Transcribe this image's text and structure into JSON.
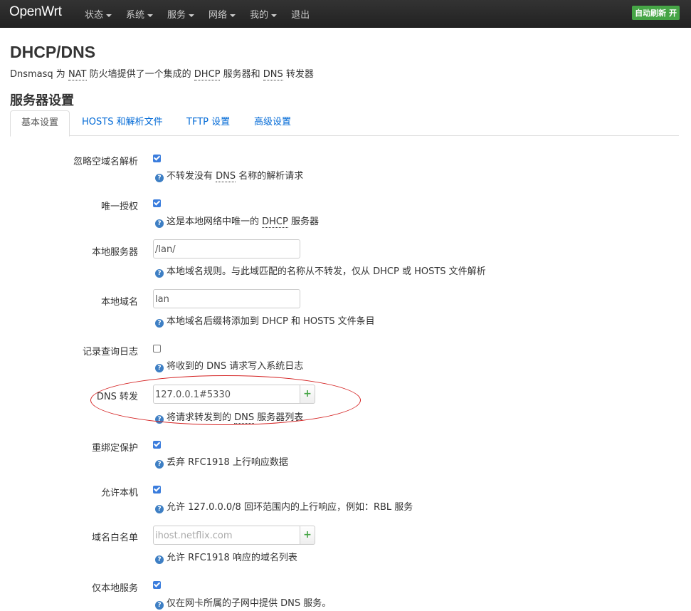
{
  "navbar": {
    "brand": "OpenWrt",
    "menu": [
      {
        "label": "状态",
        "dropdown": true
      },
      {
        "label": "系统",
        "dropdown": true
      },
      {
        "label": "服务",
        "dropdown": true
      },
      {
        "label": "网络",
        "dropdown": true
      },
      {
        "label": "我的",
        "dropdown": true
      },
      {
        "label": "退出",
        "dropdown": false
      }
    ],
    "refresh_badge": "自动刷新 开"
  },
  "page": {
    "title": "DHCP/DNS",
    "description_parts": [
      "Dnsmasq 为 ",
      "NAT",
      " 防火墙提供了一个集成的 ",
      "DHCP",
      " 服务器和 ",
      "DNS",
      " 转发器"
    ]
  },
  "section": {
    "title": "服务器设置",
    "tabs": [
      "基本设置",
      "HOSTS 和解析文件",
      "TFTP 设置",
      "高级设置"
    ]
  },
  "fields": {
    "domainneeded": {
      "label": "忽略空域名解析",
      "checked": true,
      "hint_parts": [
        "不转发没有 ",
        "DNS",
        " 名称的解析请求"
      ]
    },
    "authoritative": {
      "label": "唯一授权",
      "checked": true,
      "hint_parts": [
        "这是本地网络中唯一的 ",
        "DHCP",
        " 服务器"
      ]
    },
    "local": {
      "label": "本地服务器",
      "value": "/lan/",
      "hint": "本地域名规则。与此域匹配的名称从不转发，仅从 DHCP 或 HOSTS 文件解析"
    },
    "domain": {
      "label": "本地域名",
      "value": "lan",
      "hint": "本地域名后缀将添加到 DHCP 和 HOSTS 文件条目"
    },
    "logqueries": {
      "label": "记录查询日志",
      "checked": false,
      "hint": "将收到的 DNS 请求写入系统日志"
    },
    "server": {
      "label": "DNS 转发",
      "value": "127.0.0.1#5330",
      "add": "+",
      "hint_parts": [
        "将请求转发到的 ",
        "DNS",
        " 服务器列表"
      ]
    },
    "rebind_protection": {
      "label": "重绑定保护",
      "checked": true,
      "hint": "丢弃 RFC1918 上行响应数据"
    },
    "rebind_localhost": {
      "label": "允许本机",
      "checked": true,
      "hint": "允许 127.0.0.0/8 回环范围内的上行响应，例如：RBL 服务"
    },
    "rebind_domain": {
      "label": "域名白名单",
      "placeholder": "ihost.netflix.com",
      "add": "+",
      "hint": "允许 RFC1918 响应的域名列表"
    },
    "localservice": {
      "label": "仅本地服务",
      "checked": true,
      "hint": "仅在网卡所属的子网中提供 DNS 服务。"
    }
  },
  "colors": {
    "accent": "#0069d6",
    "badge": "#46a546",
    "checkbox": "#3b7ddd",
    "annotation": "#d42020"
  }
}
